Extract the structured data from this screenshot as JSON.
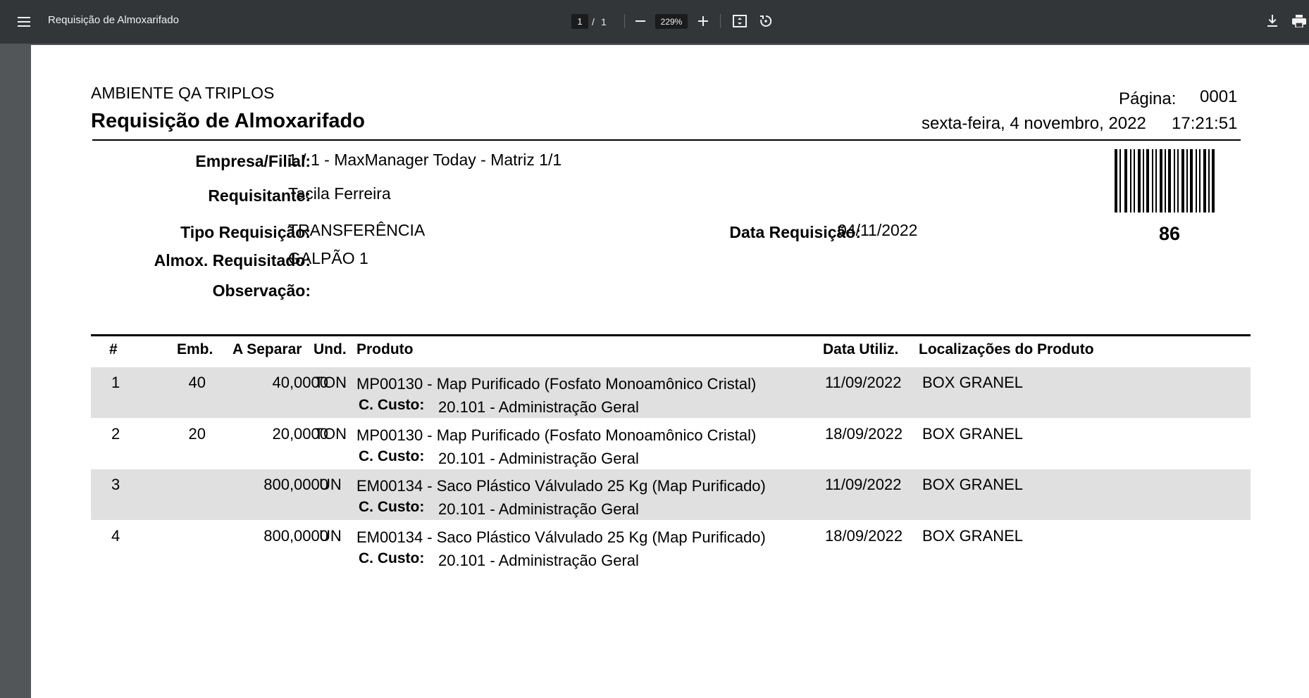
{
  "viewer": {
    "title": "Requisição de Almoxarifado",
    "current_page": "1",
    "page_separator": "/",
    "total_pages": "1",
    "zoom": "229%"
  },
  "report": {
    "environment": "AMBIENTE QA TRIPLOS",
    "title": "Requisição de Almoxarifado",
    "page_label": "Página:",
    "page_value": "0001",
    "date_text": "sexta-feira, 4 novembro, 2022",
    "time_text": "17:21:51",
    "fields": {
      "empresa_label": "Empresa/Filial:",
      "empresa_value": "1 / 1 - MaxManager Today - Matriz 1/1",
      "requisitante_label": "Requisitante:",
      "requisitante_value": "Tacila Ferreira",
      "tipo_label": "Tipo Requisição:",
      "tipo_value": "TRANSFERÊNCIA",
      "almox_label": "Almox. Requisitado:",
      "almox_value": "GALPÃO 1",
      "obs_label": "Observação:",
      "data_req_label": "Data Requisição:",
      "data_req_value": "04/11/2022"
    },
    "barcode_number": "86",
    "table": {
      "headers": {
        "num": "#",
        "emb": "Emb.",
        "separar": "A Separar",
        "und": "Und.",
        "produto": "Produto",
        "data_util": "Data Utiliz.",
        "localizacoes": "Localizações do Produto"
      },
      "rows": [
        {
          "num": "1",
          "emb": "40",
          "separar": "40,0000",
          "und": "TON",
          "produto": "MP00130 - Map Purificado (Fosfato Monoamônico Cristal)",
          "custo_label": "C. Custo:",
          "custo_value": "20.101 - Administração Geral",
          "data": "11/09/2022",
          "local": "BOX GRANEL"
        },
        {
          "num": "2",
          "emb": "20",
          "separar": "20,0000",
          "und": "TON",
          "produto": "MP00130 - Map Purificado (Fosfato Monoamônico Cristal)",
          "custo_label": "C. Custo:",
          "custo_value": "20.101 - Administração Geral",
          "data": "18/09/2022",
          "local": "BOX GRANEL"
        },
        {
          "num": "3",
          "emb": "",
          "separar": "800,0000",
          "und": "UN",
          "produto": "EM00134 - Saco Plástico Válvulado 25 Kg (Map Purificado)",
          "custo_label": "C. Custo:",
          "custo_value": "20.101 - Administração Geral",
          "data": "11/09/2022",
          "local": "BOX GRANEL"
        },
        {
          "num": "4",
          "emb": "",
          "separar": "800,0000",
          "und": "UN",
          "produto": "EM00134 - Saco Plástico Válvulado 25 Kg (Map Purificado)",
          "custo_label": "C. Custo:",
          "custo_value": "20.101 - Administração Geral",
          "data": "18/09/2022",
          "local": "BOX GRANEL"
        }
      ]
    }
  }
}
